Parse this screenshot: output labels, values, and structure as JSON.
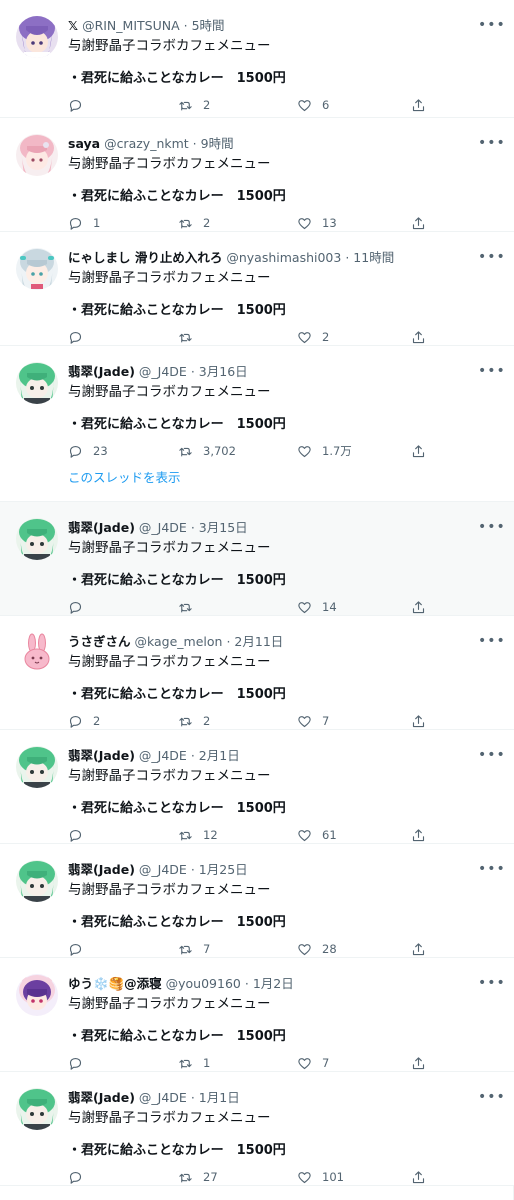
{
  "tweets": [
    {
      "name": "𝕏",
      "handle": "@RIN_MITSUNA",
      "sep": "·",
      "time": "5時間",
      "text": "与謝野晶子コラボカフェメニュー",
      "menu_item": "・君死に給ふことなカレー　1500円",
      "replies": "",
      "retweets": "2",
      "likes": "6",
      "avatar": "purple-hair-avatar"
    },
    {
      "name": "saya",
      "handle": "@crazy_nkmt",
      "sep": "·",
      "time": "9時間",
      "text": "与謝野晶子コラボカフェメニュー",
      "menu_item": "・君死に給ふことなカレー　1500円",
      "replies": "1",
      "retweets": "2",
      "likes": "13",
      "avatar": "pink-hair-avatar"
    },
    {
      "name": "にゃしまし 滑り止め入れろ",
      "handle": "@nyashimashi003",
      "sep": "·",
      "time": "11時間",
      "text": "与謝野晶子コラボカフェメニュー",
      "menu_item": "・君死に給ふことなカレー　1500円",
      "replies": "",
      "retweets": "",
      "likes": "2",
      "avatar": "silver-hair-avatar"
    },
    {
      "name": "翡翠(Jade)",
      "handle": "@_J4DE",
      "sep": "·",
      "time": "3月16日",
      "text": "与謝野晶子コラボカフェメニュー",
      "menu_item": "・君死に給ふことなカレー　1500円",
      "replies": "23",
      "retweets": "3,702",
      "likes": "1.7万",
      "thread_link": "このスレッドを表示",
      "avatar": "green-hair-avatar"
    },
    {
      "name": "翡翠(Jade)",
      "handle": "@_J4DE",
      "sep": "·",
      "time": "3月15日",
      "text": "与謝野晶子コラボカフェメニュー",
      "menu_item": "・君死に給ふことなカレー　1500円",
      "replies": "",
      "retweets": "",
      "likes": "14",
      "avatar": "green-hair-avatar"
    },
    {
      "name": "うさぎさん",
      "handle": "@kage_melon",
      "sep": "·",
      "time": "2月11日",
      "text": "与謝野晶子コラボカフェメニュー",
      "menu_item": "・君死に給ふことなカレー　1500円",
      "replies": "2",
      "retweets": "2",
      "likes": "7",
      "avatar": "pink-rabbit-avatar"
    },
    {
      "name": "翡翠(Jade)",
      "handle": "@_J4DE",
      "sep": "·",
      "time": "2月1日",
      "text": "与謝野晶子コラボカフェメニュー",
      "menu_item": "・君死に給ふことなカレー　1500円",
      "replies": "",
      "retweets": "12",
      "likes": "61",
      "avatar": "green-hair-avatar"
    },
    {
      "name": "翡翠(Jade)",
      "handle": "@_J4DE",
      "sep": "·",
      "time": "1月25日",
      "text": "与謝野晶子コラボカフェメニュー",
      "menu_item": "・君死に給ふことなカレー　1500円",
      "replies": "",
      "retweets": "7",
      "likes": "28",
      "avatar": "green-hair-avatar"
    },
    {
      "name": "ゆう❄️🥞@添寝",
      "handle": "@you09160",
      "sep": "·",
      "time": "1月2日",
      "text": "与謝野晶子コラボカフェメニュー",
      "menu_item": "・君死に給ふことなカレー　1500円",
      "replies": "",
      "retweets": "1",
      "likes": "7",
      "avatar": "purple-hood-avatar"
    },
    {
      "name": "翡翠(Jade)",
      "handle": "@_J4DE",
      "sep": "·",
      "time": "1月1日",
      "text": "与謝野晶子コラボカフェメニュー",
      "menu_item": "・君死に給ふことなカレー　1500円",
      "replies": "",
      "retweets": "27",
      "likes": "101",
      "avatar": "green-hair-avatar"
    }
  ],
  "colors": {
    "text": "#0f1419",
    "muted": "#536471",
    "link": "#1d9bf0",
    "divider": "#eff3f4",
    "shaded_row": "#f7f9f9"
  }
}
